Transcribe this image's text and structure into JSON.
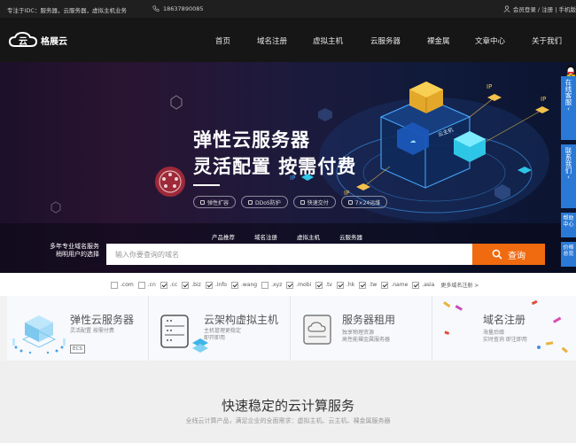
{
  "topbar": {
    "slogan": "专注于IDC：服务器，云服务器，虚拟主机业务",
    "phone": "18637890085",
    "user_links": "会员登录 / 注册 | 手机版"
  },
  "header": {
    "brand": "格展云",
    "nav": [
      "首页",
      "域名注册",
      "虚拟主机",
      "云服务器",
      "裸金属",
      "文章中心",
      "关于我们"
    ]
  },
  "hero": {
    "title_line1": "弹性云服务器",
    "title_line2": "灵活配置 按需付费",
    "tags": [
      "弹性扩容",
      "DDoS防护",
      "快速交付",
      "7×24运维"
    ]
  },
  "search": {
    "tabs": [
      "产品推荐",
      "域名注册",
      "虚拟主机",
      "云服务器"
    ],
    "note_line1": "多年专业域名服务",
    "note_line2": "稍明用户的选择",
    "placeholder": "输入你要查询的域名",
    "button_label": "查询"
  },
  "suffixes": [
    {
      "label": ".com",
      "checked": false
    },
    {
      "label": ".cn",
      "checked": false
    },
    {
      "label": ".cc",
      "checked": true
    },
    {
      "label": ".biz",
      "checked": true
    },
    {
      "label": ".info",
      "checked": true
    },
    {
      "label": ".wang",
      "checked": true
    },
    {
      "label": ".xyz",
      "checked": false
    },
    {
      "label": ".mobi",
      "checked": true
    },
    {
      "label": ".tv",
      "checked": true
    },
    {
      "label": ".hk",
      "checked": true
    },
    {
      "label": ".tw",
      "checked": true
    },
    {
      "label": ".name",
      "checked": true
    },
    {
      "label": ".asia",
      "checked": true
    }
  ],
  "more_suffix": "更多域名注册 >",
  "cards": [
    {
      "title": "弹性云服务器",
      "desc1": "灵活配置 按需付费",
      "desc2": "",
      "badge": "ECS",
      "icon": "cloud-server-icon"
    },
    {
      "title": "云架构虚拟主机",
      "desc1": "主机管理更稳定",
      "desc2": "即开即用",
      "badge": "",
      "icon": "server-rack-icon"
    },
    {
      "title": "服务器租用",
      "desc1": "独享物理资源",
      "desc2": "高性能裸金属服务器",
      "badge": "",
      "icon": "cloud-box-icon"
    },
    {
      "title": "域名注册",
      "desc1": "海量后缀",
      "desc2": "实时查询 即注即用",
      "badge": "",
      "icon": "domain-icon"
    }
  ],
  "section": {
    "title": "快速稳定的云计算服务",
    "subtitle": "全线云计算产品，满足企业的全面需求：虚拟主机、云主机、裸金属服务器"
  },
  "float": {
    "online": "在线客服",
    "contact": "联系我们",
    "help": "帮助中心",
    "price": "价格总览"
  },
  "colors": {
    "accent": "#f06a0f",
    "header_bg": "#161616",
    "float_blue": "#2a79d6"
  }
}
